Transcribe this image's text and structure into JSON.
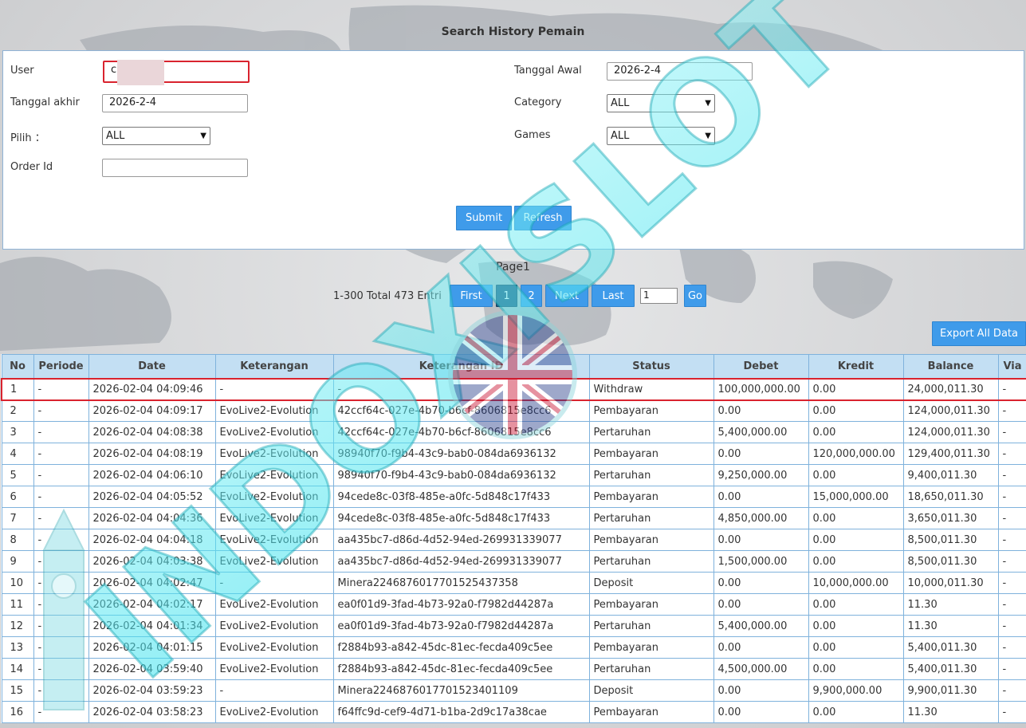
{
  "header": {
    "title": "Search History Pemain"
  },
  "form": {
    "user_label": "User",
    "user_value": "c",
    "tanggal_awal_label": "Tanggal Awal",
    "tanggal_awal_value": "2026-2-4",
    "tanggal_akhir_label": "Tanggal akhir",
    "tanggal_akhir_value": "2026-2-4",
    "category_label": "Category",
    "category_value": "ALL",
    "pilih_label": "Pilih ：",
    "pilih_value": "ALL",
    "games_label": "Games",
    "games_value": "ALL",
    "order_label": "Order Id",
    "order_value": "",
    "submit_label": "Submit",
    "refresh_label": "Refresh"
  },
  "pagination": {
    "page_label": "Page1",
    "summary": "1-300 Total 473 Entri",
    "first_label": "First",
    "page1_label": "1",
    "page2_label": "2",
    "next_label": "Next",
    "last_label": "Last",
    "go_value": "1",
    "go_label": "Go"
  },
  "export": {
    "label": "Export All Data"
  },
  "table": {
    "headers": [
      "No",
      "Periode",
      "Date",
      "Keterangan",
      "Keterangan ID",
      "Status",
      "Debet",
      "Kredit",
      "Balance",
      "Via"
    ],
    "rows": [
      {
        "no": "1",
        "periode": "-",
        "date": "2026-02-04 04:09:46",
        "ket": "-",
        "ket_id": "-",
        "status": "Withdraw",
        "debet": "100,000,000.00",
        "kredit": "0.00",
        "balance": "24,000,011.30",
        "via": "-"
      },
      {
        "no": "2",
        "periode": "-",
        "date": "2026-02-04 04:09:17",
        "ket": "EvoLive2-Evolution",
        "ket_id": "42ccf64c-027e-4b70-b6cf-8606815e8cc6",
        "status": "Pembayaran",
        "debet": "0.00",
        "kredit": "0.00",
        "balance": "124,000,011.30",
        "via": "-"
      },
      {
        "no": "3",
        "periode": "-",
        "date": "2026-02-04 04:08:38",
        "ket": "EvoLive2-Evolution",
        "ket_id": "42ccf64c-027e-4b70-b6cf-8606815e8cc6",
        "status": "Pertaruhan",
        "debet": "5,400,000.00",
        "kredit": "0.00",
        "balance": "124,000,011.30",
        "via": "-"
      },
      {
        "no": "4",
        "periode": "-",
        "date": "2026-02-04 04:08:19",
        "ket": "EvoLive2-Evolution",
        "ket_id": "98940f70-f9b4-43c9-bab0-084da6936132",
        "status": "Pembayaran",
        "debet": "0.00",
        "kredit": "120,000,000.00",
        "balance": "129,400,011.30",
        "via": "-"
      },
      {
        "no": "5",
        "periode": "-",
        "date": "2026-02-04 04:06:10",
        "ket": "EvoLive2-Evolution",
        "ket_id": "98940f70-f9b4-43c9-bab0-084da6936132",
        "status": "Pertaruhan",
        "debet": "9,250,000.00",
        "kredit": "0.00",
        "balance": "9,400,011.30",
        "via": "-"
      },
      {
        "no": "6",
        "periode": "-",
        "date": "2026-02-04 04:05:52",
        "ket": "EvoLive2-Evolution",
        "ket_id": "94cede8c-03f8-485e-a0fc-5d848c17f433",
        "status": "Pembayaran",
        "debet": "0.00",
        "kredit": "15,000,000.00",
        "balance": "18,650,011.30",
        "via": "-"
      },
      {
        "no": "7",
        "periode": "-",
        "date": "2026-02-04 04:04:36",
        "ket": "EvoLive2-Evolution",
        "ket_id": "94cede8c-03f8-485e-a0fc-5d848c17f433",
        "status": "Pertaruhan",
        "debet": "4,850,000.00",
        "kredit": "0.00",
        "balance": "3,650,011.30",
        "via": "-"
      },
      {
        "no": "8",
        "periode": "-",
        "date": "2026-02-04 04:04:18",
        "ket": "EvoLive2-Evolution",
        "ket_id": "aa435bc7-d86d-4d52-94ed-269931339077",
        "status": "Pembayaran",
        "debet": "0.00",
        "kredit": "0.00",
        "balance": "8,500,011.30",
        "via": "-"
      },
      {
        "no": "9",
        "periode": "-",
        "date": "2026-02-04 04:03:38",
        "ket": "EvoLive2-Evolution",
        "ket_id": "aa435bc7-d86d-4d52-94ed-269931339077",
        "status": "Pertaruhan",
        "debet": "1,500,000.00",
        "kredit": "0.00",
        "balance": "8,500,011.30",
        "via": "-"
      },
      {
        "no": "10",
        "periode": "-",
        "date": "2026-02-04 04:02:47",
        "ket": "-",
        "ket_id": "Minera2246876017701525437358",
        "status": "Deposit",
        "debet": "0.00",
        "kredit": "10,000,000.00",
        "balance": "10,000,011.30",
        "via": "-"
      },
      {
        "no": "11",
        "periode": "-",
        "date": "2026-02-04 04:02:17",
        "ket": "EvoLive2-Evolution",
        "ket_id": "ea0f01d9-3fad-4b73-92a0-f7982d44287a",
        "status": "Pembayaran",
        "debet": "0.00",
        "kredit": "0.00",
        "balance": "11.30",
        "via": "-"
      },
      {
        "no": "12",
        "periode": "-",
        "date": "2026-02-04 04:01:34",
        "ket": "EvoLive2-Evolution",
        "ket_id": "ea0f01d9-3fad-4b73-92a0-f7982d44287a",
        "status": "Pertaruhan",
        "debet": "5,400,000.00",
        "kredit": "0.00",
        "balance": "11.30",
        "via": "-"
      },
      {
        "no": "13",
        "periode": "-",
        "date": "2026-02-04 04:01:15",
        "ket": "EvoLive2-Evolution",
        "ket_id": "f2884b93-a842-45dc-81ec-fecda409c5ee",
        "status": "Pembayaran",
        "debet": "0.00",
        "kredit": "0.00",
        "balance": "5,400,011.30",
        "via": "-"
      },
      {
        "no": "14",
        "periode": "-",
        "date": "2026-02-04 03:59:40",
        "ket": "EvoLive2-Evolution",
        "ket_id": "f2884b93-a842-45dc-81ec-fecda409c5ee",
        "status": "Pertaruhan",
        "debet": "4,500,000.00",
        "kredit": "0.00",
        "balance": "5,400,011.30",
        "via": "-"
      },
      {
        "no": "15",
        "periode": "-",
        "date": "2026-02-04 03:59:23",
        "ket": "-",
        "ket_id": "Minera2246876017701523401109",
        "status": "Deposit",
        "debet": "0.00",
        "kredit": "9,900,000.00",
        "balance": "9,900,011.30",
        "via": "-"
      },
      {
        "no": "16",
        "periode": "-",
        "date": "2026-02-04 03:58:23",
        "ket": "EvoLive2-Evolution",
        "ket_id": "f64ffc9d-cef9-4d71-b1ba-2d9c17a38cae",
        "status": "Pembayaran",
        "debet": "0.00",
        "kredit": "0.00",
        "balance": "11.30",
        "via": "-"
      }
    ]
  },
  "colors": {
    "accent_blue": "#3f9bea",
    "highlight_red": "#d9232e",
    "link": "#3d8fd1",
    "table_header": "#c3dff3"
  },
  "watermark": {
    "text": "INDOXISLOT"
  }
}
